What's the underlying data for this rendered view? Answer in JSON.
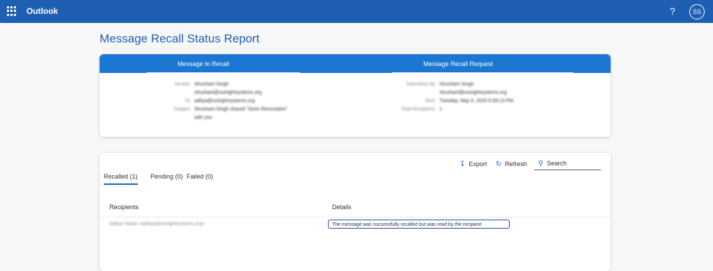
{
  "app": {
    "name": "Outlook",
    "help": "?",
    "user_initials": "SS"
  },
  "page": {
    "title": "Message Recall Status Report"
  },
  "recall_card": {
    "message_header": "Message to Recall",
    "request_header": "Message Recall Request",
    "message": {
      "sender_label": "Sender",
      "sender_name": "Shushant Singh",
      "sender_email": "shushant@outrightsystems.org",
      "to_label": "To",
      "to_value": "aditya@outrightsystems.org",
      "subject_label": "Subject",
      "subject_line1": "Shushant Singh shared \"Store Renovation\"",
      "subject_line2": "with you"
    },
    "request": {
      "submitted_label": "Submitted By",
      "submitted_name": "Shushant Singh",
      "submitted_email": "shushant@outrightsystems.org",
      "sent_label": "Sent",
      "sent_value": "Tuesday, May 6, 2025 5:08:13 PM",
      "total_label": "Total Recipients",
      "total_value": "1"
    }
  },
  "results": {
    "toolbar": {
      "export": "Export",
      "refresh": "Refresh",
      "search": "Search"
    },
    "tabs": [
      "Recalled (1)",
      "Pending (0)",
      "Failed (0)"
    ],
    "columns": {
      "recipients": "Recipients",
      "details": "Details"
    },
    "rows": [
      {
        "recipient": "Aditya Yadav <aditya@outrightsystems.org>",
        "details": "The message was successfully recalled but was read by the recipient"
      }
    ]
  },
  "colors": {
    "accent": "#1e5fb4",
    "header": "#1c77d2"
  }
}
